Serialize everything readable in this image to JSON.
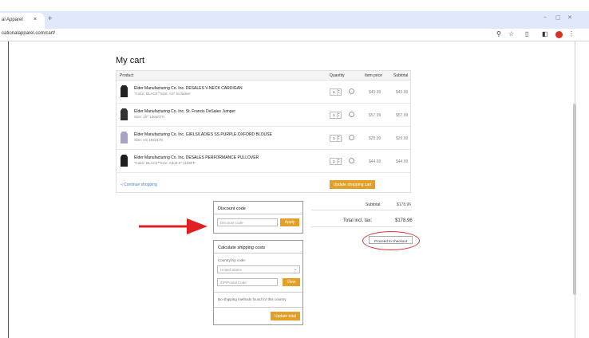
{
  "browser": {
    "tab_title": "al Apparel",
    "tab_close": "×",
    "new_tab": "+",
    "url": "cationalapparel.com/cart/",
    "icons": [
      "zoom-icon",
      "star-icon",
      "extensions-icon",
      "sidepanel-icon",
      "profile-icon",
      "menu-icon"
    ],
    "zoom_glyph": "⚲",
    "star_glyph": "☆",
    "ext_glyph": "▯",
    "side_glyph": "◧",
    "menu_glyph": "⋮",
    "min_glyph": "–",
    "max_glyph": "▢",
    "close_glyph": "✕"
  },
  "cart": {
    "title": "My cart",
    "headers": {
      "product": "Product",
      "quantity": "Quantity",
      "item_price": "Item price",
      "subtotal": "Subtotal"
    },
    "items": [
      {
        "name": "Elder Manufacturing Co. Inc. DESALES V-NECK CARDIGAN",
        "meta": "\"Color: BLACK\"\"Size: AS\" Includes!",
        "qty": "1",
        "price": "$45.99",
        "subtotal": "$45.99",
        "color": "#222222"
      },
      {
        "name": "Elder Manufacturing Co. Inc. St. Francis DeSales Jumper",
        "meta": "Size: 10\" 1dep/OTI",
        "qty": "1",
        "price": "$57.99",
        "subtotal": "$57.99",
        "color": "#333333"
      },
      {
        "name": "Elder Manufacturing Co. Inc. GIRLS/LADIES SS PURPLE OXFORD BLOUSE",
        "meta": "Size: AS 1942178",
        "qty": "1",
        "price": "$25.99",
        "subtotal": "$25.99",
        "color": "#a9a2c8"
      },
      {
        "name": "Elder Manufacturing Co. Inc. DESALES PERFORMANCE PULLOVER",
        "meta": "\"Color: BLACK\"\"Size: Adult S\" 1106FP",
        "qty": "1",
        "price": "$44.99",
        "subtotal": "$44.99",
        "color": "#1e1e1e"
      }
    ],
    "continue_label": "« Continue shopping",
    "update_label": "Update shopping cart"
  },
  "discount": {
    "title": "Discount code",
    "placeholder": "Discount code",
    "apply_label": "Apply"
  },
  "shipping": {
    "title": "Calculate shipping costs",
    "country_label": "Country/zip code:",
    "country_value": "United States",
    "zip_placeholder": "ZIP/Postal Code",
    "view_label": "View",
    "no_methods": "No shipping methods found for this country",
    "update_total_label": "Update total"
  },
  "totals": {
    "subtotal_label": "Subtotal:",
    "subtotal_value": "$178.96",
    "total_label": "Total incl. tax:",
    "total_value": "$178.96",
    "checkout_label": "Proceed to checkout"
  },
  "annotations": {
    "arrow_color": "#e02020",
    "circle_color": "#d83a3a"
  },
  "colors": {
    "accent": "#e3a025",
    "link": "#4a7fd4"
  }
}
